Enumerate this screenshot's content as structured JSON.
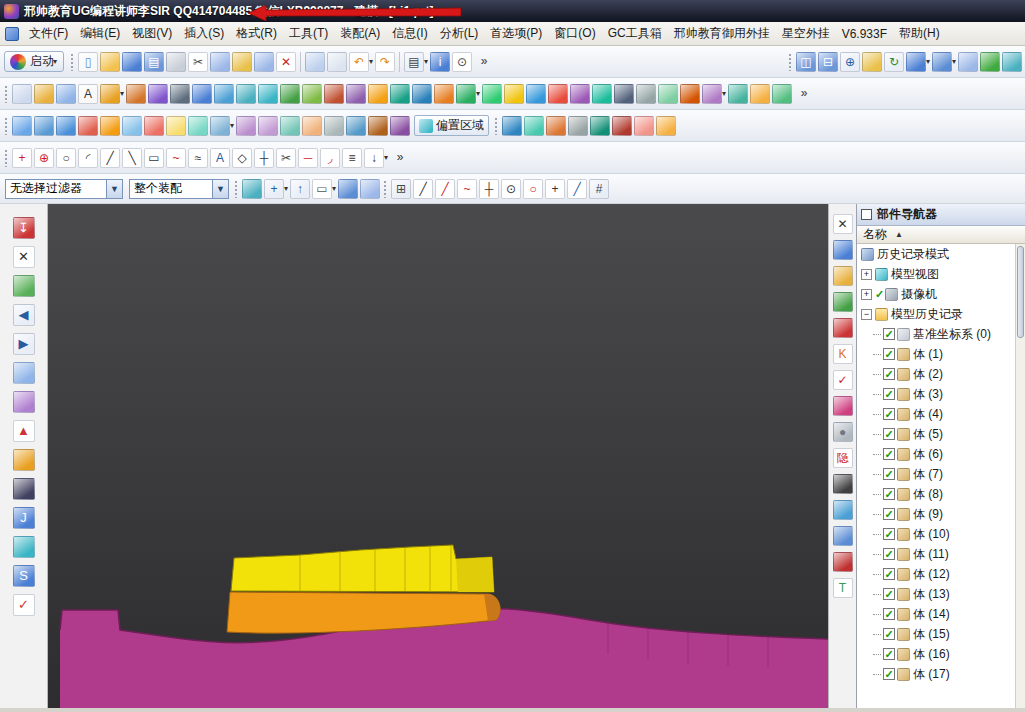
{
  "window": {
    "title": "邢帅教育UG编程讲师李SIR  QQ414704485  微信LXB998877 - 建模 - [Li1.prt]"
  },
  "menu": {
    "items": [
      "文件(F)",
      "编辑(E)",
      "视图(V)",
      "插入(S)",
      "格式(R)",
      "工具(T)",
      "装配(A)",
      "信息(I)",
      "分析(L)",
      "首选项(P)",
      "窗口(O)",
      "GC工具箱",
      "邢帅教育御用外挂",
      "星空外挂",
      "V6.933F",
      "帮助(H)"
    ]
  },
  "toolbars": {
    "start_label": "启动",
    "offset_region_label": "偏置区域",
    "row1_left": [
      {
        "n": "new-file",
        "c": "#f8f8f8",
        "g": "▯",
        "gc": "#5b8dd4"
      },
      {
        "n": "open-folder",
        "c": "#f2c14e"
      },
      {
        "n": "save",
        "c": "#4a7fd4"
      },
      {
        "n": "save-all",
        "c": "#6b97d8",
        "g": "▤",
        "gc": "#ffffff"
      },
      {
        "n": "print",
        "c": "#c8ced8"
      },
      {
        "n": "cut",
        "c": "#ffffff",
        "g": "✂",
        "gc": "#444444"
      },
      {
        "n": "copy",
        "c": "#9db8e8"
      },
      {
        "n": "paste",
        "c": "#e8c04a"
      },
      {
        "n": "copy-special",
        "c": "#9db8e8"
      },
      {
        "n": "delete",
        "c": "#ffffff",
        "g": "✕",
        "gc": "#cc2222"
      },
      {
        "sep": true
      },
      {
        "n": "erase-display",
        "c": "#bcd0ee"
      },
      {
        "n": "fit-window",
        "c": "#dce4f0"
      },
      {
        "n": "undo",
        "c": "#ffffff",
        "g": "↶",
        "gc": "#e08820",
        "dd": true
      },
      {
        "n": "redo",
        "c": "#ffffff",
        "g": "↷",
        "gc": "#e08820"
      },
      {
        "sep": true
      },
      {
        "n": "display-mode",
        "c": "#e8edf6",
        "g": "▤",
        "gc": "#444444",
        "dd": true
      },
      {
        "n": "part-info",
        "c": "#4a7fd4",
        "g": "i",
        "gc": "#ffffff"
      },
      {
        "n": "zoom-find",
        "c": "#ffffff",
        "g": "⊙",
        "gc": "#444444"
      },
      {
        "n": "overflow-chevron",
        "c": "transparent",
        "g": "»",
        "gc": "#333333"
      }
    ],
    "row1_right": [
      {
        "n": "window-cascade",
        "c": "#6b97d8",
        "g": "◫",
        "gc": "#ffffff"
      },
      {
        "n": "window-tile",
        "c": "#6b97d8",
        "g": "⊟",
        "gc": "#ffffff"
      },
      {
        "n": "zoom-view",
        "c": "#e8edf6",
        "g": "⊕",
        "gc": "#2a5aa0"
      },
      {
        "n": "capture-image",
        "c": "#e8c04a"
      },
      {
        "n": "refresh-view",
        "c": "#e8edf6",
        "g": "↻",
        "gc": "#2a8a2a"
      },
      {
        "n": "orient-view",
        "c": "#4a7fd4",
        "dd": true
      },
      {
        "n": "render-shaded",
        "c": "#5b8dd4",
        "dd": true
      },
      {
        "n": "render-wireframe",
        "c": "#9db8e8"
      },
      {
        "n": "layer-settings",
        "c": "#3faa3f"
      },
      {
        "n": "view-cube",
        "c": "#4ab0c0"
      }
    ],
    "row2": [
      {
        "n": "datum-plane",
        "c": "#cdd9ee"
      },
      {
        "n": "sketch",
        "c": "#e8b13d"
      },
      {
        "n": "curve",
        "c": "#8fb4e8"
      },
      {
        "n": "text",
        "c": "#f8f8f8",
        "g": "A",
        "gc": "#333333"
      },
      {
        "n": "extrude",
        "c": "#e8a020",
        "dd": true
      },
      {
        "n": "revolve",
        "c": "#d4762a"
      },
      {
        "n": "swept",
        "c": "#8055cc"
      },
      {
        "n": "tube",
        "c": "#5d6d7e"
      },
      {
        "n": "block",
        "c": "#4a7fd4"
      },
      {
        "n": "cylinder",
        "c": "#4a9fd4"
      },
      {
        "n": "cone",
        "c": "#4ab0c0"
      },
      {
        "n": "sphere",
        "c": "#3ab5c5"
      },
      {
        "n": "hole",
        "c": "#44a044"
      },
      {
        "n": "boss",
        "c": "#7fba45"
      },
      {
        "n": "pocket",
        "c": "#c05030"
      },
      {
        "n": "pad",
        "c": "#8e5ead"
      },
      {
        "n": "emboss",
        "c": "#f3a012"
      },
      {
        "n": "rib",
        "c": "#16a085"
      },
      {
        "n": "shell",
        "c": "#2980b9"
      },
      {
        "n": "draft",
        "c": "#e67e22"
      },
      {
        "n": "edge-blend",
        "c": "#27ae60",
        "dd": true
      },
      {
        "n": "face-blend",
        "c": "#2ecc71"
      },
      {
        "n": "chamfer",
        "c": "#f1c40f"
      },
      {
        "n": "unite",
        "c": "#3498db"
      },
      {
        "n": "subtract",
        "c": "#e74c3c"
      },
      {
        "n": "intersect",
        "c": "#9b59b6"
      },
      {
        "n": "trim-body",
        "c": "#1abc9c"
      },
      {
        "n": "split-body",
        "c": "#53627c"
      },
      {
        "n": "offset-face",
        "c": "#95a5a6"
      },
      {
        "n": "thicken",
        "c": "#7dcea0"
      },
      {
        "n": "scale-body",
        "c": "#d35400"
      },
      {
        "n": "through-curves",
        "c": "#af7ac5",
        "dd": true
      },
      {
        "n": "ruled-surface",
        "c": "#45b39d"
      },
      {
        "n": "n-sided-surface",
        "c": "#f5b041"
      },
      {
        "n": "studio-surface",
        "c": "#52be80"
      },
      {
        "n": "more-features",
        "c": "transparent",
        "g": "»",
        "gc": "#333333"
      }
    ],
    "row3_a": [
      {
        "n": "move-face",
        "c": "#6aa7e8"
      },
      {
        "n": "pull-face",
        "c": "#5b9bd5"
      },
      {
        "n": "replace-face",
        "c": "#4a90d9"
      },
      {
        "n": "delete-face",
        "c": "#e06050"
      },
      {
        "n": "resize-face",
        "c": "#f39c12"
      },
      {
        "n": "copy-face",
        "c": "#85c1e9"
      },
      {
        "n": "cut-face",
        "c": "#ec7063"
      },
      {
        "n": "paste-face",
        "c": "#f7dc6f"
      },
      {
        "n": "mirror-feature",
        "c": "#76d7c4"
      },
      {
        "n": "pattern-feature",
        "c": "#7fb3d5",
        "dd": true
      },
      {
        "n": "x-form",
        "c": "#bb8fce"
      },
      {
        "n": "i-form",
        "c": "#c39bd3"
      },
      {
        "n": "sew",
        "c": "#73c6b6"
      },
      {
        "n": "unsew",
        "c": "#f0b27a"
      },
      {
        "n": "bounded-plane",
        "c": "#aab7b8"
      },
      {
        "n": "curve-mesh",
        "c": "#5499c7"
      },
      {
        "n": "sweep-along-guide",
        "c": "#af601a"
      },
      {
        "n": "variational-sweep",
        "c": "#884ea0"
      }
    ],
    "row3_b": [
      {
        "n": "law-extension",
        "c": "#2e86c1"
      },
      {
        "n": "extension-surface",
        "c": "#48c9b0"
      },
      {
        "n": "silhouette-flange",
        "c": "#dc7633"
      },
      {
        "n": "offset-surface",
        "c": "#99a3a4"
      },
      {
        "n": "trimmed-sheet",
        "c": "#148f77"
      },
      {
        "n": "untrim",
        "c": "#b03a2e"
      },
      {
        "n": "wrap-geometry",
        "c": "#f1948a"
      },
      {
        "n": "global-shaping",
        "c": "#f5b041"
      }
    ],
    "row4": [
      {
        "n": "point",
        "c": "#ffffff",
        "g": "+",
        "gc": "#cc2222"
      },
      {
        "n": "point-set",
        "c": "#ffffff",
        "g": "⊕",
        "gc": "#cc2222"
      },
      {
        "n": "circle",
        "c": "#ffffff",
        "g": "○",
        "gc": "#333333"
      },
      {
        "n": "arc",
        "c": "#ffffff",
        "g": "◜",
        "gc": "#333333"
      },
      {
        "n": "line",
        "c": "#ffffff",
        "g": "╱",
        "gc": "#333333"
      },
      {
        "n": "profile",
        "c": "#ffffff",
        "g": "╲",
        "gc": "#333333"
      },
      {
        "n": "rectangle",
        "c": "#ffffff",
        "g": "▭",
        "gc": "#333333"
      },
      {
        "n": "spline",
        "c": "#ffffff",
        "g": "~",
        "gc": "#cc2222"
      },
      {
        "n": "studio-spline",
        "c": "#ffffff",
        "g": "≈",
        "gc": "#333333"
      },
      {
        "n": "sketch-text",
        "c": "#ffffff",
        "g": "A",
        "gc": "#2a5aa0"
      },
      {
        "n": "ellipse",
        "c": "#ffffff",
        "g": "◇",
        "gc": "#333333"
      },
      {
        "n": "intersection-curve",
        "c": "#ffffff",
        "g": "┼",
        "gc": "#333333"
      },
      {
        "n": "trim-curve",
        "c": "#ffffff",
        "g": "✂",
        "gc": "#444444"
      },
      {
        "n": "divide-curve",
        "c": "#ffffff",
        "g": "─",
        "gc": "#cc2222"
      },
      {
        "n": "fillet-curve",
        "c": "#ffffff",
        "g": "◞",
        "gc": "#cc2222"
      },
      {
        "n": "offset-curve",
        "c": "#ffffff",
        "g": "≡",
        "gc": "#333333"
      },
      {
        "n": "project-curve",
        "c": "#ffffff",
        "g": "↓",
        "gc": "#333333",
        "dd": true
      },
      {
        "n": "more-curves",
        "c": "transparent",
        "g": "»",
        "gc": "#333333"
      }
    ],
    "selection": {
      "filter_value": "无选择过滤器",
      "scope_value": "整个装配"
    },
    "row5_a": [
      {
        "n": "selection-preferences",
        "c": "#4ab0c0"
      },
      {
        "n": "add-to-selection",
        "c": "#e8edf6",
        "g": "+",
        "gc": "#2a5aa0",
        "dd": true
      },
      {
        "n": "move-up",
        "c": "#e8edf6",
        "g": "↑",
        "gc": "#2a5aa0"
      },
      {
        "n": "rectangle-select",
        "c": "#ffffff",
        "g": "▭",
        "gc": "#555555",
        "dd": true
      },
      {
        "n": "shaded-select",
        "c": "#5b8dd4"
      },
      {
        "n": "highlight-body",
        "c": "#9db8e8"
      }
    ],
    "row5_b": [
      {
        "n": "enable-snap-point",
        "c": "#e8edf6",
        "g": "⊞",
        "gc": "#444444"
      },
      {
        "n": "snap-end-point",
        "c": "#ffffff",
        "g": "╱",
        "gc": "#333333"
      },
      {
        "n": "snap-mid-point",
        "c": "#ffffff",
        "g": "╱",
        "gc": "#cc2222"
      },
      {
        "n": "snap-control-point",
        "c": "#ffffff",
        "g": "~",
        "gc": "#cc2222"
      },
      {
        "n": "snap-intersection",
        "c": "#ffffff",
        "g": "┼",
        "gc": "#333333"
      },
      {
        "n": "snap-arc-center",
        "c": "#ffffff",
        "g": "⊙",
        "gc": "#333333"
      },
      {
        "n": "snap-quadrant",
        "c": "#ffffff",
        "g": "○",
        "gc": "#cc2222"
      },
      {
        "n": "snap-existing-point",
        "c": "#ffffff",
        "g": "+",
        "gc": "#333333"
      },
      {
        "n": "snap-point-on-curve",
        "c": "#ffffff",
        "g": "╱",
        "gc": "#2a5aa0"
      },
      {
        "n": "grid-snap",
        "c": "#e8edf6",
        "g": "#",
        "gc": "#444444"
      }
    ]
  },
  "sidebar": {
    "icons": [
      {
        "n": "abs-csys",
        "c": "#cc3333",
        "g": "↧",
        "gc": "#ffffff"
      },
      {
        "n": "close-part",
        "c": "#ffffff",
        "g": "✕",
        "gc": "#333333"
      },
      {
        "n": "new-sheet",
        "c": "#58b058"
      },
      {
        "n": "back",
        "c": "#e8edf6",
        "g": "◀",
        "gc": "#2a5aa0"
      },
      {
        "n": "forward",
        "c": "#e8edf6",
        "g": "▶",
        "gc": "#2a5aa0"
      },
      {
        "n": "erase",
        "c": "#8fb4e8"
      },
      {
        "n": "transform",
        "c": "#b080d0"
      },
      {
        "n": "raise-flag",
        "c": "#ffffff",
        "g": "▲",
        "gc": "#cc3333"
      },
      {
        "n": "orange-box",
        "c": "#e8a020"
      },
      {
        "n": "dark-cube",
        "c": "#404060"
      },
      {
        "n": "revolve-tool",
        "c": "#4a7fd4",
        "g": "J",
        "gc": "#ffffff"
      },
      {
        "n": "half-sphere",
        "c": "#3ab5c5"
      },
      {
        "n": "sweep-tool",
        "c": "#4a7fd4",
        "g": "S",
        "gc": "#ffffff"
      },
      {
        "n": "verify-check",
        "c": "#ffffff",
        "g": "✓",
        "gc": "#cc3333"
      }
    ]
  },
  "strip": {
    "icons": [
      {
        "n": "close-x",
        "c": "#ffffff",
        "g": "✕",
        "gc": "#333333"
      },
      {
        "n": "pushpin",
        "c": "#4a7fd4"
      },
      {
        "n": "clipboard",
        "c": "#e8b13d"
      },
      {
        "n": "green-chip",
        "c": "#44a044"
      },
      {
        "n": "abs-small",
        "c": "#cc3333"
      },
      {
        "n": "kk-tool",
        "c": "#ffffff",
        "g": "K",
        "gc": "#e07020"
      },
      {
        "n": "red-check",
        "c": "#ffffff",
        "g": "✓",
        "gc": "#cc2222"
      },
      {
        "n": "color-palette",
        "c": "#d04080"
      },
      {
        "n": "gray-sphere",
        "c": "#b0b8c0",
        "g": "●",
        "gc": "#707880"
      },
      {
        "n": "hide-tool",
        "c": "#ffffff",
        "g": "隐",
        "gc": "#cc2222"
      },
      {
        "n": "render-cube",
        "c": "#404040"
      },
      {
        "n": "blue-cylinder",
        "c": "#4a9fd4"
      },
      {
        "n": "doc-blue",
        "c": "#5b8dd4"
      },
      {
        "n": "red-green-sphere",
        "c": "#c03030"
      },
      {
        "n": "t-green",
        "c": "#ffffff",
        "g": "T",
        "gc": "#30a050"
      }
    ]
  },
  "navigator": {
    "title": "部件导航器",
    "column": "名称",
    "sort": "▲",
    "items": [
      {
        "label": "历史记录模式",
        "level": 0,
        "icon": "history"
      },
      {
        "label": "模型视图",
        "level": 0,
        "icon": "views",
        "expander": "+"
      },
      {
        "label": "摄像机",
        "level": 0,
        "icon": "camera",
        "expander": "+",
        "check": true
      },
      {
        "label": "模型历史记录",
        "level": 0,
        "icon": "folder",
        "expander": "-"
      },
      {
        "label": "基准坐标系 (0)",
        "level": 1,
        "icon": "csys",
        "checkbox": true
      },
      {
        "label": "体 (1)",
        "level": 1,
        "icon": "body",
        "checkbox": true
      },
      {
        "label": "体 (2)",
        "level": 1,
        "icon": "body",
        "checkbox": true
      },
      {
        "label": "体 (3)",
        "level": 1,
        "icon": "body",
        "checkbox": true
      },
      {
        "label": "体 (4)",
        "level": 1,
        "icon": "body",
        "checkbox": true
      },
      {
        "label": "体 (5)",
        "level": 1,
        "icon": "body",
        "checkbox": true
      },
      {
        "label": "体 (6)",
        "level": 1,
        "icon": "body",
        "checkbox": true
      },
      {
        "label": "体 (7)",
        "level": 1,
        "icon": "body",
        "checkbox": true
      },
      {
        "label": "体 (8)",
        "level": 1,
        "icon": "body",
        "checkbox": true
      },
      {
        "label": "体 (9)",
        "level": 1,
        "icon": "body",
        "checkbox": true
      },
      {
        "label": "体 (10)",
        "level": 1,
        "icon": "body",
        "checkbox": true
      },
      {
        "label": "体 (11)",
        "level": 1,
        "icon": "body",
        "checkbox": true
      },
      {
        "label": "体 (12)",
        "level": 1,
        "icon": "body",
        "checkbox": true
      },
      {
        "label": "体 (13)",
        "level": 1,
        "icon": "body",
        "checkbox": true
      },
      {
        "label": "体 (14)",
        "level": 1,
        "icon": "body",
        "checkbox": true
      },
      {
        "label": "体 (15)",
        "level": 1,
        "icon": "body",
        "checkbox": true
      },
      {
        "label": "体 (16)",
        "level": 1,
        "icon": "body",
        "checkbox": true
      },
      {
        "label": "体 (17)",
        "level": 1,
        "icon": "body",
        "checkbox": true
      }
    ]
  },
  "colors": {
    "accent": "#2a5aa0",
    "viewport_top": "#4a4a4c",
    "viewport_bottom": "#2d2d2f",
    "model_magenta": "#b03a8c",
    "model_magenta_edge": "#6e1e56",
    "model_orange": "#f09a18",
    "model_orange_dark": "#c87818",
    "model_yellow": "#f2e20a",
    "model_yellow_dark": "#e0cc08",
    "annotation_red": "#d81818"
  }
}
